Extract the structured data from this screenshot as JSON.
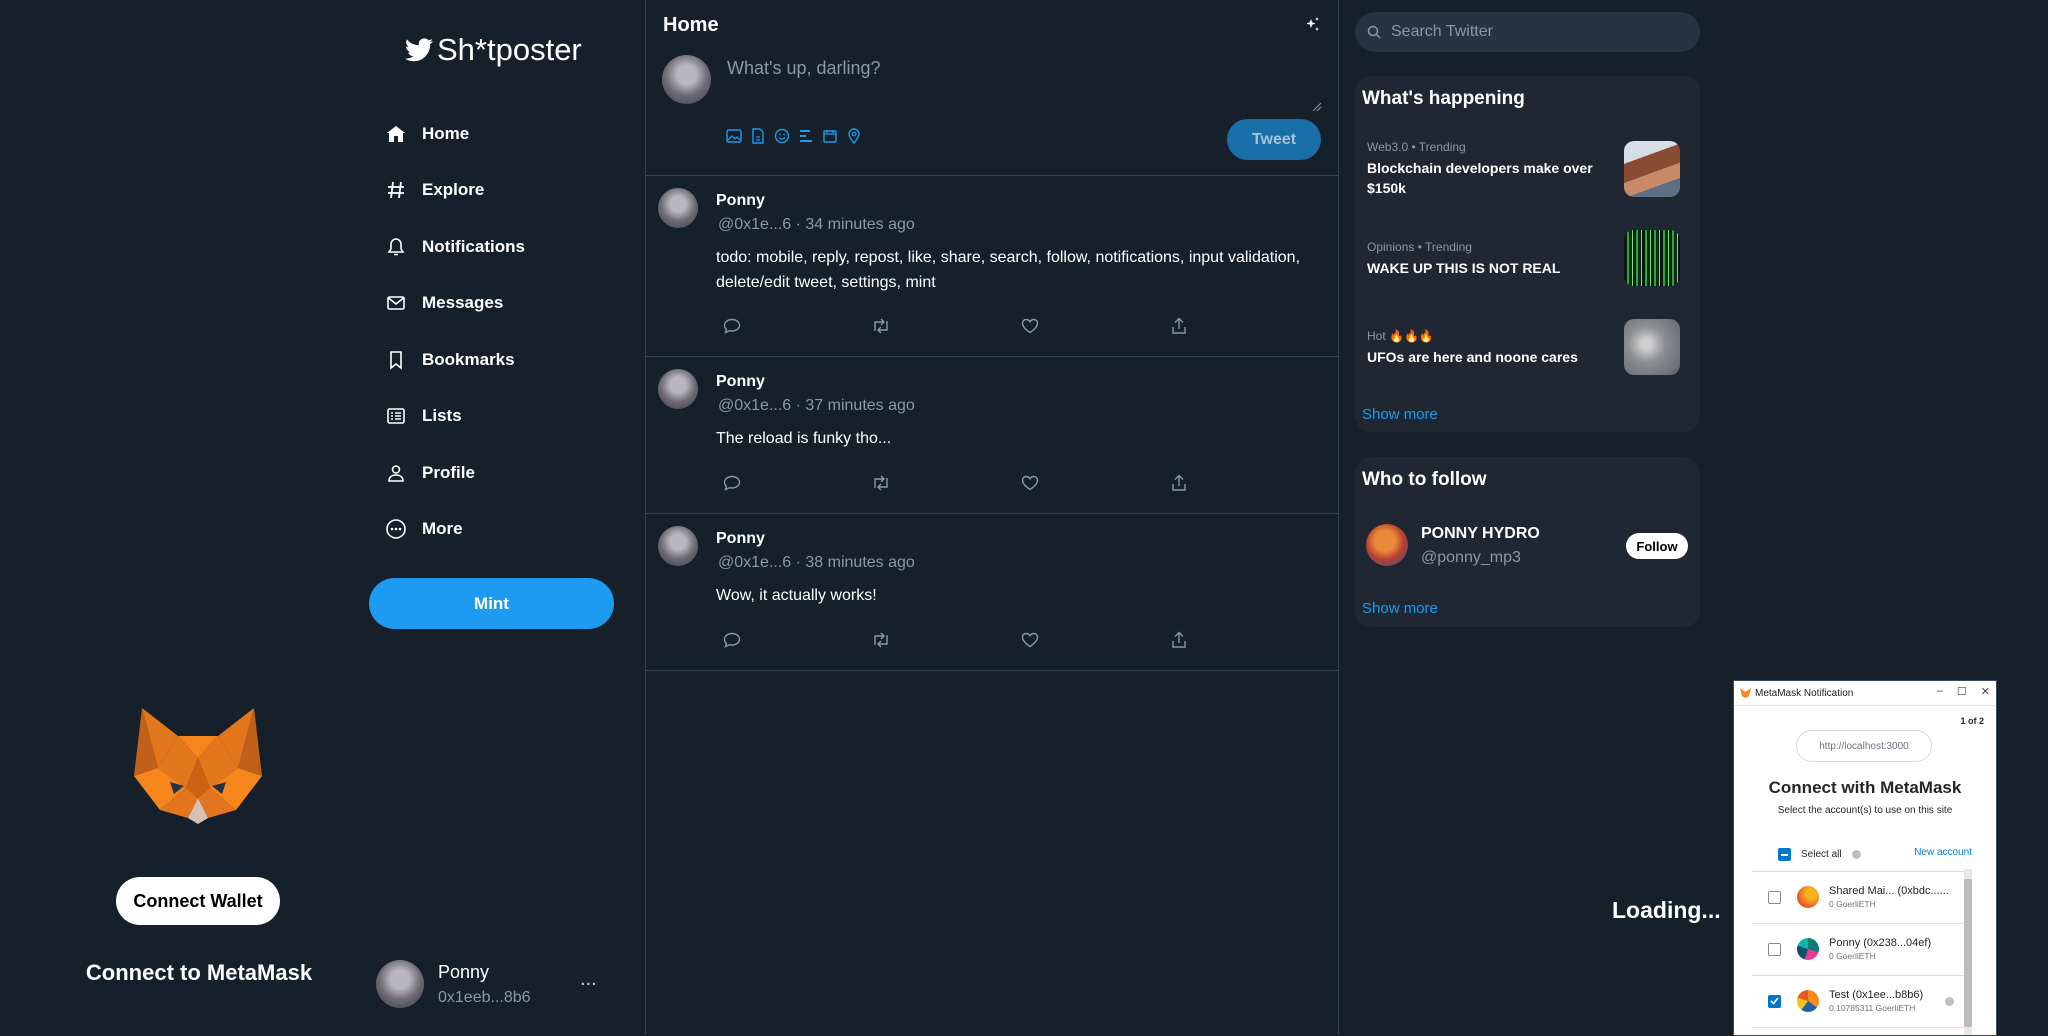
{
  "connect_panel": {
    "wallet_button": "Connect Wallet",
    "heading": "Connect to MetaMask"
  },
  "sidebar": {
    "logo_text": "Sh*tposter",
    "items": [
      {
        "label": "Home",
        "icon": "home-icon"
      },
      {
        "label": "Explore",
        "icon": "hashtag-icon"
      },
      {
        "label": "Notifications",
        "icon": "bell-icon"
      },
      {
        "label": "Messages",
        "icon": "envelope-icon"
      },
      {
        "label": "Bookmarks",
        "icon": "bookmark-icon"
      },
      {
        "label": "Lists",
        "icon": "list-icon"
      },
      {
        "label": "Profile",
        "icon": "person-icon"
      },
      {
        "label": "More",
        "icon": "more-circle-icon"
      }
    ],
    "mint_label": "Mint",
    "user": {
      "name": "Ponny",
      "handle": "0x1eeb...8b6",
      "more": "..."
    }
  },
  "feed": {
    "title": "Home",
    "compose_placeholder": "What's up, darling?",
    "tweet_button": "Tweet",
    "tweets": [
      {
        "name": "Ponny",
        "meta": "@0x1e...6 · 34 minutes ago",
        "text": "todo: mobile, reply, repost, like, share, search, follow, notifications, input validation, delete/edit tweet, settings, mint"
      },
      {
        "name": "Ponny",
        "meta": "@0x1e...6 · 37 minutes ago",
        "text": "The reload is funky tho..."
      },
      {
        "name": "Ponny",
        "meta": "@0x1e...6 · 38 minutes ago",
        "text": "Wow, it actually works!"
      }
    ]
  },
  "right": {
    "search_placeholder": "Search Twitter",
    "happening": {
      "title": "What's happening",
      "trends": [
        {
          "category": "Web3.0 • Trending",
          "title": "Blockchain developers make over $150k"
        },
        {
          "category": "Opinions • Trending",
          "title": "WAKE UP THIS IS NOT REAL"
        },
        {
          "category": "Hot 🔥🔥🔥",
          "title": "UFOs are here and noone cares"
        }
      ],
      "show_more": "Show more"
    },
    "who_to_follow": {
      "title": "Who to follow",
      "user": {
        "name": "PONNY HYDRO",
        "handle": "@ponny_mp3"
      },
      "follow_label": "Follow",
      "show_more": "Show more"
    },
    "loading": "Loading..."
  },
  "metamask": {
    "window_title": "MetaMask Notification",
    "window_buttons": {
      "minimize": "–",
      "maximize": "☐",
      "close": "✕"
    },
    "page_count": "1 of 2",
    "origin": "http://localhost:3000",
    "heading": "Connect with MetaMask",
    "subheading": "Select the account(s) to use on this site",
    "select_all": "Select all",
    "new_account": "New account",
    "accounts": [
      {
        "name": "Shared Mai... (0xbdc......",
        "balance": "0 GoerliETH",
        "checked": false
      },
      {
        "name": "Ponny (0x238...04ef)",
        "balance": "0 GoerliETH",
        "checked": false
      },
      {
        "name": "Test (0x1ee...b8b6)",
        "balance": "0.10785311 GoerliETH",
        "checked": true
      }
    ]
  },
  "colors": {
    "background": "#15202b",
    "accent": "#1d9bf0",
    "muted_text": "#8b98a5",
    "border": "#38444d",
    "card": "#1e2732"
  }
}
